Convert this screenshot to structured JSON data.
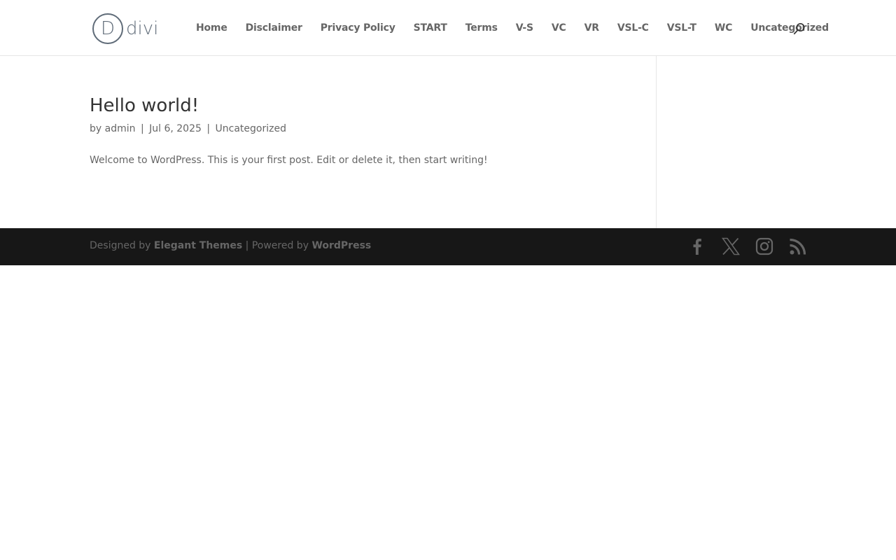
{
  "header": {
    "logo_text": "divi",
    "logo_letter": "D",
    "nav": [
      {
        "label": "Home"
      },
      {
        "label": "Disclaimer"
      },
      {
        "label": "Privacy Policy"
      },
      {
        "label": "START"
      },
      {
        "label": "Terms"
      },
      {
        "label": "V-S"
      },
      {
        "label": "VC"
      },
      {
        "label": "VR"
      },
      {
        "label": "VSL-C"
      },
      {
        "label": "VSL-T"
      },
      {
        "label": "WC"
      },
      {
        "label": "Uncategorized"
      }
    ],
    "search_icon": "search-icon"
  },
  "post": {
    "title": "Hello world!",
    "meta_by": "by",
    "author": "admin",
    "date": "Jul 6, 2025",
    "category": "Uncategorized",
    "separator": "|",
    "excerpt": "Welcome to WordPress. This is your first post. Edit or delete it, then start writing!"
  },
  "footer": {
    "designed_by": "Designed by",
    "theme_link": "Elegant Themes",
    "powered_by": "| Powered by",
    "wordpress_link": "WordPress",
    "social_icons": [
      "facebook-icon",
      "x-twitter-icon",
      "instagram-icon",
      "rss-icon"
    ]
  },
  "colors": {
    "nav_text": "#666666",
    "title_text": "#333333",
    "footer_bg": "#171717",
    "footer_icons": "#666666",
    "logo": "#5f6b78"
  }
}
